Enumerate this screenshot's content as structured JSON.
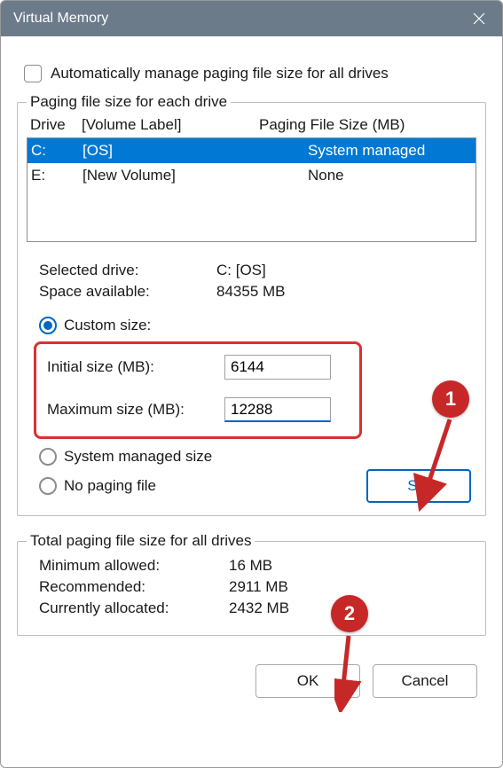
{
  "window": {
    "title": "Virtual Memory"
  },
  "auto_manage": {
    "label": "Automatically manage paging file size for all drives",
    "checked": false
  },
  "fieldset_drive": {
    "legend": "Paging file size for each drive",
    "header": {
      "drive": "Drive",
      "volume": "[Volume Label]",
      "size": "Paging File Size (MB)"
    },
    "rows": [
      {
        "drive": "C:",
        "volume": "[OS]",
        "size": "System managed",
        "selected": true
      },
      {
        "drive": "E:",
        "volume": "[New Volume]",
        "size": "None",
        "selected": false
      }
    ]
  },
  "selected": {
    "drive_label": "Selected drive:",
    "drive_value": "C:  [OS]",
    "space_label": "Space available:",
    "space_value": "84355 MB"
  },
  "options": {
    "custom_label": "Custom size:",
    "initial_label": "Initial size (MB):",
    "initial_value": "6144",
    "maximum_label": "Maximum size (MB):",
    "maximum_value": "12288",
    "system_managed_label": "System managed size",
    "no_paging_label": "No paging file"
  },
  "set_button": "Set",
  "fieldset_total": {
    "legend": "Total paging file size for all drives",
    "min_label": "Minimum allowed:",
    "min_value": "16 MB",
    "rec_label": "Recommended:",
    "rec_value": "2911 MB",
    "cur_label": "Currently allocated:",
    "cur_value": "2432 MB"
  },
  "buttons": {
    "ok": "OK",
    "cancel": "Cancel"
  },
  "annotations": {
    "a1": "1",
    "a2": "2"
  }
}
